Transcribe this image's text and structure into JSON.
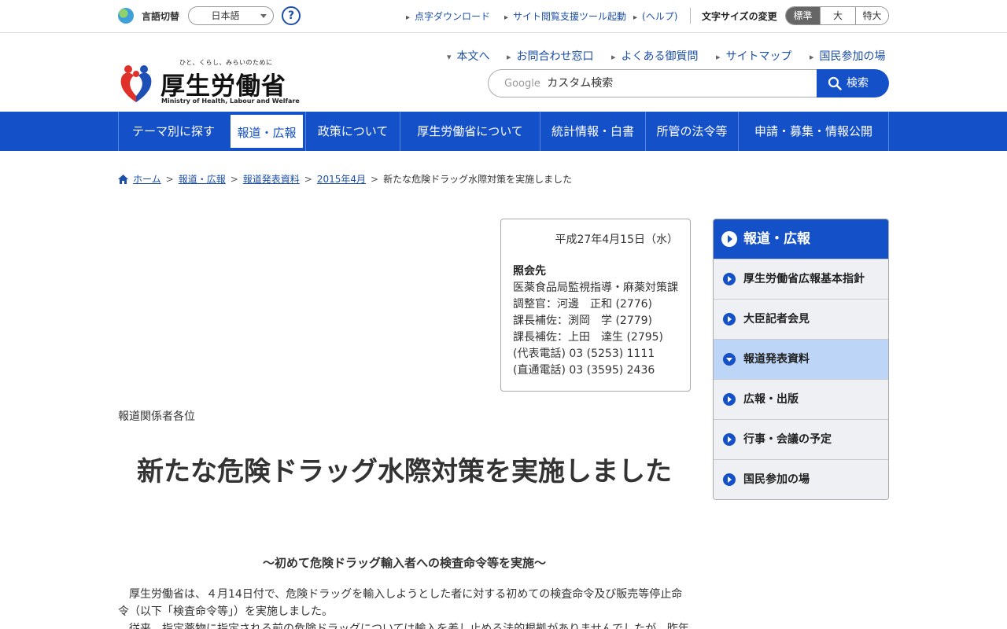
{
  "util": {
    "lang_label": "言語切替",
    "lang_value": "日本語",
    "help": "?",
    "links": [
      "点字ダウンロード",
      "サイト閲覧支援ツール起動",
      "(ヘルプ)"
    ],
    "fontsize_label": "文字サイズの変更",
    "fontsizes": [
      "標準",
      "大",
      "特大"
    ]
  },
  "header": {
    "tagline": "ひと、くらし、みらいのために",
    "logo_text": "厚生労働省",
    "logo_en": "Ministry of Health, Labour and Welfare",
    "links": [
      "本文へ",
      "お問合わせ窓口",
      "よくある御質問",
      "サイトマップ",
      "国民参加の場"
    ],
    "search_google": "Google",
    "search_placeholder": "カスタム検索",
    "search_button": "検索"
  },
  "gnav": [
    "テーマ別に探す",
    "報道・広報",
    "政策について",
    "厚生労働省について",
    "統計情報・白書",
    "所管の法令等",
    "申請・募集・情報公開"
  ],
  "breadcrumb": {
    "items": [
      "ホーム",
      "報道・広報",
      "報道発表資料",
      "2015年4月"
    ],
    "current": "新たな危険ドラッグ水際対策を実施しました"
  },
  "contact": {
    "date": "平成27年4月15日（水）",
    "heading": "照会先",
    "lines": [
      "医薬食品局監視指導・麻薬対策課",
      "調整官：河邊　正和 (2776)",
      "課長補佐：渕岡　学 (2779)",
      "課長補佐：上田　達生 (2795)",
      "(代表電話) 03 (5253) 1111",
      "(直通電話) 03 (3595) 2436"
    ]
  },
  "main": {
    "addressee": "報道関係者各位",
    "title": "新たな危険ドラッグ水際対策を実施しました",
    "subtitle": "～初めて危険ドラッグ輸入者への検査命令等を実施～",
    "para1": "厚生労働省は、４月14日付で、危険ドラッグを輸入しようとした者に対する初めての検査命令及び販売等停止命令（以下「検査命令等」）を実施しました。",
    "para2": "従来、指定薬物に指定される前の危険ドラッグについては輸入を差し止める法的根拠がありませんでしたが、昨年"
  },
  "side": {
    "heading": "報道・広報",
    "items": [
      "厚生労働省広報基本指針",
      "大臣記者会見",
      "報道発表資料",
      "広報・出版",
      "行事・会議の予定",
      "国民参加の場"
    ],
    "current_index": 2
  },
  "colors": {
    "brand_blue": "#1450c8",
    "link": "#1c4fa8",
    "current_bg": "#bdd6f7"
  }
}
